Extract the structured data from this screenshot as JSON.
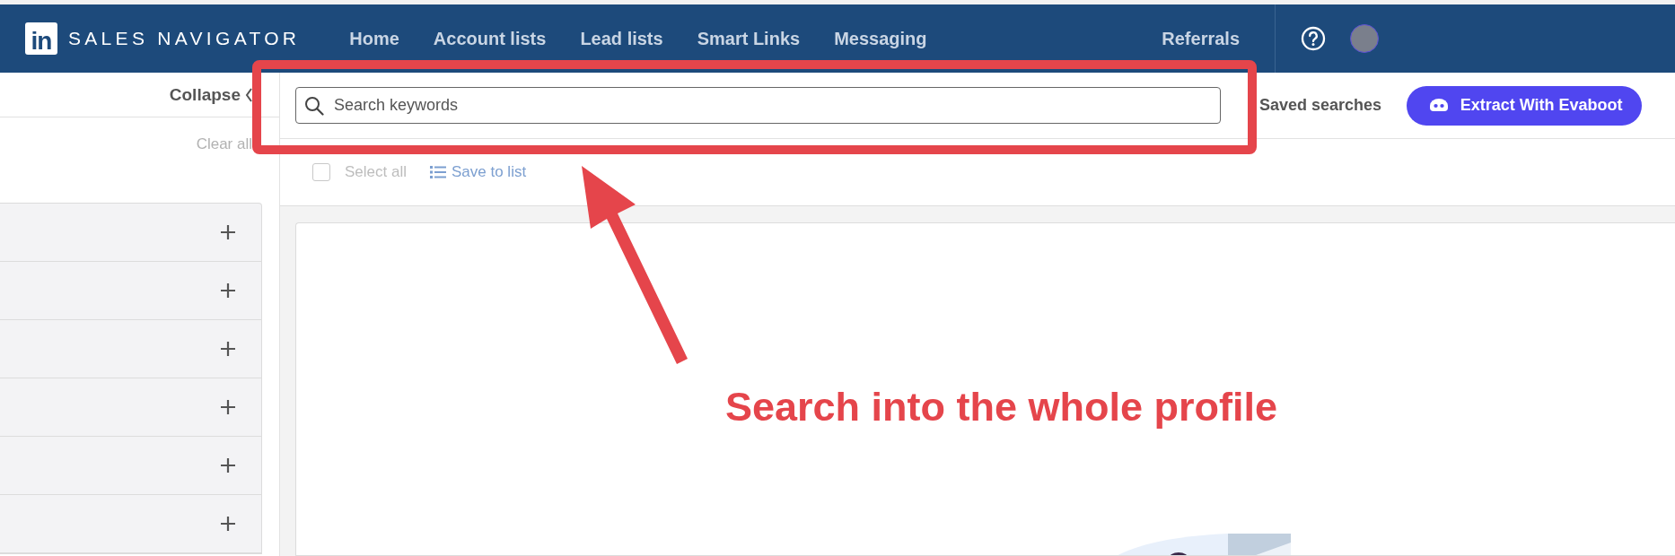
{
  "brand": {
    "logo": "in",
    "name": "SALES NAVIGATOR"
  },
  "nav": {
    "items": [
      {
        "label": "Home"
      },
      {
        "label": "Account lists"
      },
      {
        "label": "Lead lists"
      },
      {
        "label": "Smart Links"
      },
      {
        "label": "Messaging"
      }
    ],
    "right_items": [
      {
        "label": "Referrals"
      }
    ]
  },
  "sidebar": {
    "collapse": "Collapse",
    "clear_all": "Clear all",
    "filters": [
      {
        "expanded": false
      },
      {
        "expanded": false
      },
      {
        "expanded": false
      },
      {
        "expanded": false
      },
      {
        "expanded": false
      },
      {
        "expanded": false
      }
    ]
  },
  "search": {
    "placeholder": "Search keywords"
  },
  "saved_searches": "Saved searches",
  "extract_button": "Extract With Evaboot",
  "toolbar": {
    "disabled": true,
    "select_all": {
      "label": "Select all",
      "checked": false
    },
    "save_to_list": "Save to list"
  },
  "annotation": {
    "text": "Search into the whole profile"
  }
}
